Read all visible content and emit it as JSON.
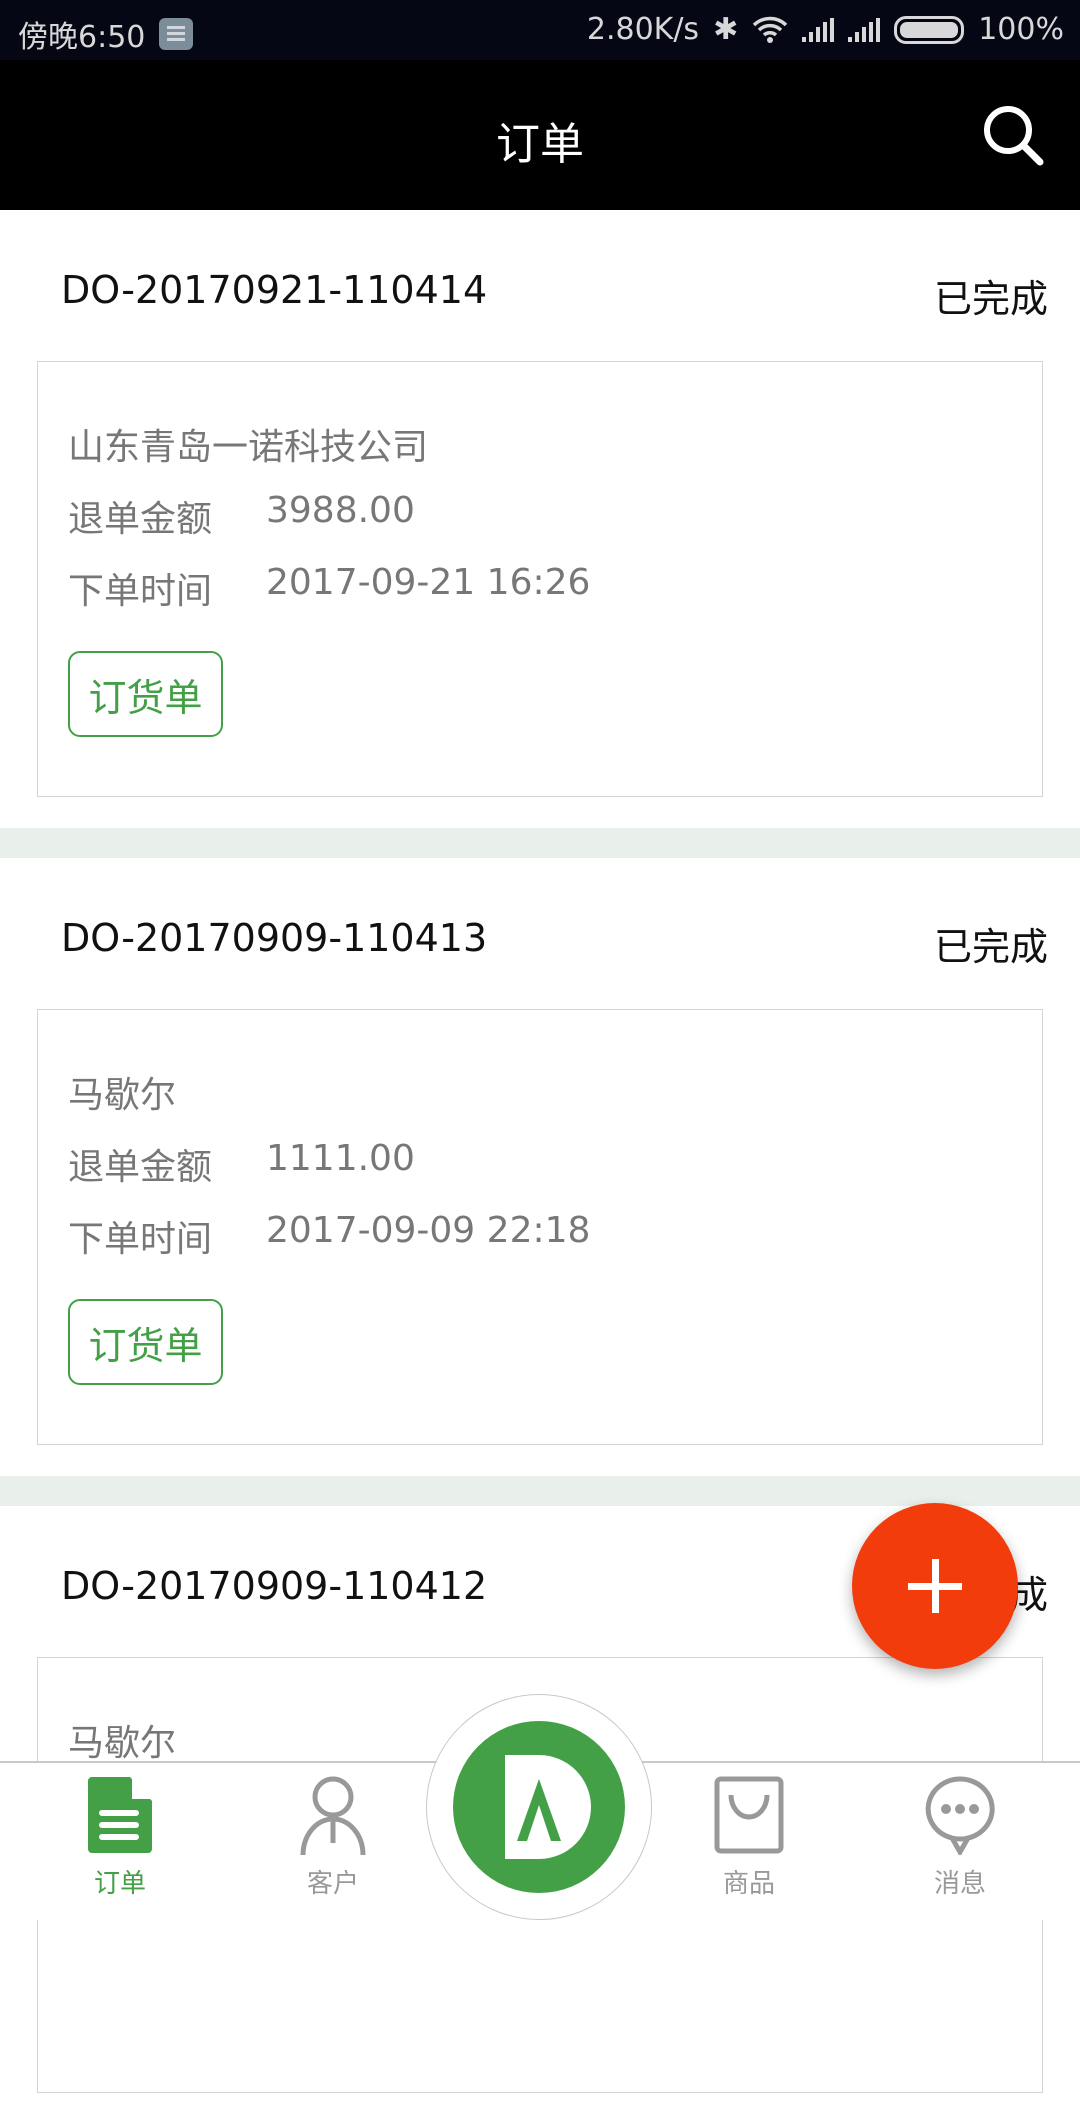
{
  "status_bar": {
    "time": "傍晚6:50",
    "speed": "2.80K/s",
    "battery": "100%"
  },
  "header": {
    "title": "订单"
  },
  "orders": [
    {
      "order_no": "DO-20170921-110414",
      "status": "已完成",
      "customer": "山东青岛一诺科技公司",
      "amount_label": "退单金额",
      "amount": "3988.00",
      "time_label": "下单时间",
      "time": "2017-09-21 16:26",
      "tag": "订货单"
    },
    {
      "order_no": "DO-20170909-110413",
      "status": "已完成",
      "customer": "马歇尔",
      "amount_label": "退单金额",
      "amount": "1111.00",
      "time_label": "下单时间",
      "time": "2017-09-09 22:18",
      "tag": "订货单"
    },
    {
      "order_no": "DO-20170909-110412",
      "status": "已完成",
      "customer": "马歇尔"
    }
  ],
  "nav": {
    "items": [
      {
        "label": "订单"
      },
      {
        "label": "客户"
      },
      {
        "label": "商品"
      },
      {
        "label": "消息"
      }
    ]
  },
  "colors": {
    "accent": "#43a047",
    "fab": "#f23c0c",
    "header": "#000000"
  }
}
